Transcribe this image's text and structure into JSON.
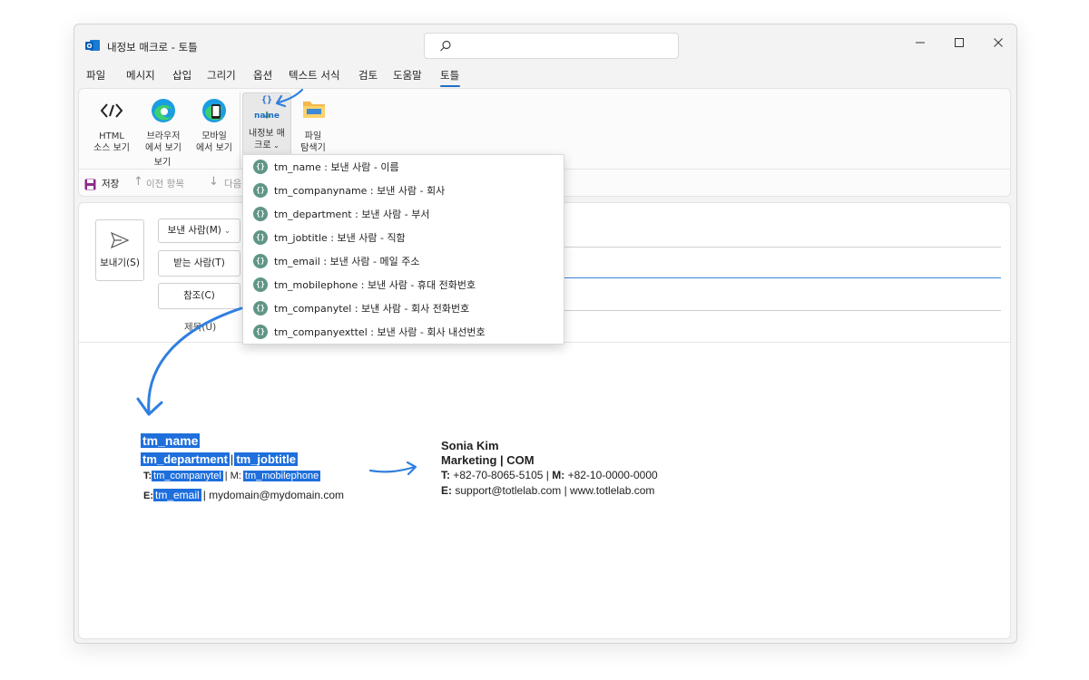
{
  "window": {
    "title": "내정보 매크로 - 토틀",
    "search_icon": "search-icon"
  },
  "menu": [
    {
      "label": "파일"
    },
    {
      "label": "메시지"
    },
    {
      "label": "삽입"
    },
    {
      "label": "그리기"
    },
    {
      "label": "옵션"
    },
    {
      "label": "텍스트 서식"
    },
    {
      "label": "검토"
    },
    {
      "label": "도움말"
    },
    {
      "label": "토틀"
    }
  ],
  "ribbon": {
    "html_line1": "HTML",
    "html_line2": "소스 보기",
    "browser_line1": "브라우저",
    "browser_line2": "에서 보기",
    "mobile_line1": "모바일",
    "mobile_line2": "에서 보기",
    "group_view": "보기",
    "macro_icon_text": "name",
    "macro_line1": "내정보 매",
    "macro_line2": "크로",
    "explorer_line1": "파일",
    "explorer_line2": "탐색기"
  },
  "qat": {
    "save": "저장",
    "prev": "이전 항목",
    "next": "다음"
  },
  "compose": {
    "send": "보내기(S)",
    "from": "보낸 사람(M)",
    "to": "받는 사람(T)",
    "cc": "참조(C)",
    "subject": "제목(U)"
  },
  "macros": [
    {
      "label": "tm_name : 보낸 사람 - 이름"
    },
    {
      "label": "tm_companyname : 보낸 사람 - 회사"
    },
    {
      "label": "tm_department : 보낸 사람 - 부서"
    },
    {
      "label": "tm_jobtitle : 보낸 사람 - 직함"
    },
    {
      "label": "tm_email : 보낸 사람 - 메일 주소"
    },
    {
      "label": "tm_mobilephone : 보낸 사람 - 휴대 전화번호"
    },
    {
      "label": "tm_companytel : 보낸 사람 - 회사 전화번호"
    },
    {
      "label": "tm_companyexttel : 보낸 사람 - 회사 내선번호"
    }
  ],
  "template_sig": {
    "name": "tm_name",
    "department": "tm_department",
    "sep": "|",
    "jobtitle": "tm_jobtitle",
    "t_label": "T:",
    "companytel": "tm_companytel",
    "m_sep": "| M:",
    "mobilephone": "tm_mobilephone",
    "e_label": "E:",
    "email": "tm_email",
    "e_rest": "| mydomain@mydomain.com"
  },
  "result_sig": {
    "name": "Sonia Kim",
    "dept_title": "Marketing | COM",
    "t_label": "T:",
    "t_value": "+82-70-8065-5105 |",
    "m_label": "M:",
    "m_value": "+82-10-0000-0000",
    "e_label": "E:",
    "e_value": "support@totlelab.com | www.totlelab.com"
  },
  "colors": {
    "accent": "#1f6fc5",
    "highlight": "#1e6fdc",
    "arrow": "#2f7fe0",
    "macro_icon": "#5f9687"
  }
}
